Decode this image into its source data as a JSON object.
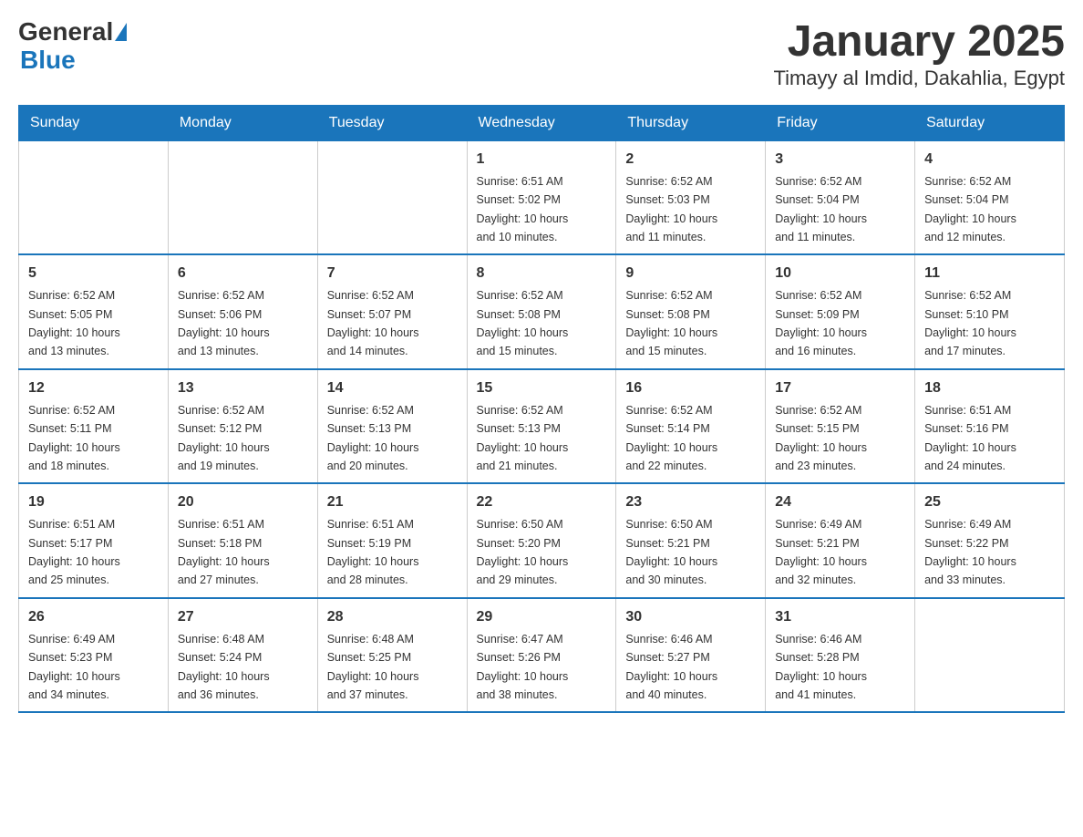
{
  "logo": {
    "part1": "General",
    "part2": "Blue"
  },
  "title": "January 2025",
  "subtitle": "Timayy al Imdid, Dakahlia, Egypt",
  "days_of_week": [
    "Sunday",
    "Monday",
    "Tuesday",
    "Wednesday",
    "Thursday",
    "Friday",
    "Saturday"
  ],
  "weeks": [
    [
      {
        "day": "",
        "info": ""
      },
      {
        "day": "",
        "info": ""
      },
      {
        "day": "",
        "info": ""
      },
      {
        "day": "1",
        "info": "Sunrise: 6:51 AM\nSunset: 5:02 PM\nDaylight: 10 hours\nand 10 minutes."
      },
      {
        "day": "2",
        "info": "Sunrise: 6:52 AM\nSunset: 5:03 PM\nDaylight: 10 hours\nand 11 minutes."
      },
      {
        "day": "3",
        "info": "Sunrise: 6:52 AM\nSunset: 5:04 PM\nDaylight: 10 hours\nand 11 minutes."
      },
      {
        "day": "4",
        "info": "Sunrise: 6:52 AM\nSunset: 5:04 PM\nDaylight: 10 hours\nand 12 minutes."
      }
    ],
    [
      {
        "day": "5",
        "info": "Sunrise: 6:52 AM\nSunset: 5:05 PM\nDaylight: 10 hours\nand 13 minutes."
      },
      {
        "day": "6",
        "info": "Sunrise: 6:52 AM\nSunset: 5:06 PM\nDaylight: 10 hours\nand 13 minutes."
      },
      {
        "day": "7",
        "info": "Sunrise: 6:52 AM\nSunset: 5:07 PM\nDaylight: 10 hours\nand 14 minutes."
      },
      {
        "day": "8",
        "info": "Sunrise: 6:52 AM\nSunset: 5:08 PM\nDaylight: 10 hours\nand 15 minutes."
      },
      {
        "day": "9",
        "info": "Sunrise: 6:52 AM\nSunset: 5:08 PM\nDaylight: 10 hours\nand 15 minutes."
      },
      {
        "day": "10",
        "info": "Sunrise: 6:52 AM\nSunset: 5:09 PM\nDaylight: 10 hours\nand 16 minutes."
      },
      {
        "day": "11",
        "info": "Sunrise: 6:52 AM\nSunset: 5:10 PM\nDaylight: 10 hours\nand 17 minutes."
      }
    ],
    [
      {
        "day": "12",
        "info": "Sunrise: 6:52 AM\nSunset: 5:11 PM\nDaylight: 10 hours\nand 18 minutes."
      },
      {
        "day": "13",
        "info": "Sunrise: 6:52 AM\nSunset: 5:12 PM\nDaylight: 10 hours\nand 19 minutes."
      },
      {
        "day": "14",
        "info": "Sunrise: 6:52 AM\nSunset: 5:13 PM\nDaylight: 10 hours\nand 20 minutes."
      },
      {
        "day": "15",
        "info": "Sunrise: 6:52 AM\nSunset: 5:13 PM\nDaylight: 10 hours\nand 21 minutes."
      },
      {
        "day": "16",
        "info": "Sunrise: 6:52 AM\nSunset: 5:14 PM\nDaylight: 10 hours\nand 22 minutes."
      },
      {
        "day": "17",
        "info": "Sunrise: 6:52 AM\nSunset: 5:15 PM\nDaylight: 10 hours\nand 23 minutes."
      },
      {
        "day": "18",
        "info": "Sunrise: 6:51 AM\nSunset: 5:16 PM\nDaylight: 10 hours\nand 24 minutes."
      }
    ],
    [
      {
        "day": "19",
        "info": "Sunrise: 6:51 AM\nSunset: 5:17 PM\nDaylight: 10 hours\nand 25 minutes."
      },
      {
        "day": "20",
        "info": "Sunrise: 6:51 AM\nSunset: 5:18 PM\nDaylight: 10 hours\nand 27 minutes."
      },
      {
        "day": "21",
        "info": "Sunrise: 6:51 AM\nSunset: 5:19 PM\nDaylight: 10 hours\nand 28 minutes."
      },
      {
        "day": "22",
        "info": "Sunrise: 6:50 AM\nSunset: 5:20 PM\nDaylight: 10 hours\nand 29 minutes."
      },
      {
        "day": "23",
        "info": "Sunrise: 6:50 AM\nSunset: 5:21 PM\nDaylight: 10 hours\nand 30 minutes."
      },
      {
        "day": "24",
        "info": "Sunrise: 6:49 AM\nSunset: 5:21 PM\nDaylight: 10 hours\nand 32 minutes."
      },
      {
        "day": "25",
        "info": "Sunrise: 6:49 AM\nSunset: 5:22 PM\nDaylight: 10 hours\nand 33 minutes."
      }
    ],
    [
      {
        "day": "26",
        "info": "Sunrise: 6:49 AM\nSunset: 5:23 PM\nDaylight: 10 hours\nand 34 minutes."
      },
      {
        "day": "27",
        "info": "Sunrise: 6:48 AM\nSunset: 5:24 PM\nDaylight: 10 hours\nand 36 minutes."
      },
      {
        "day": "28",
        "info": "Sunrise: 6:48 AM\nSunset: 5:25 PM\nDaylight: 10 hours\nand 37 minutes."
      },
      {
        "day": "29",
        "info": "Sunrise: 6:47 AM\nSunset: 5:26 PM\nDaylight: 10 hours\nand 38 minutes."
      },
      {
        "day": "30",
        "info": "Sunrise: 6:46 AM\nSunset: 5:27 PM\nDaylight: 10 hours\nand 40 minutes."
      },
      {
        "day": "31",
        "info": "Sunrise: 6:46 AM\nSunset: 5:28 PM\nDaylight: 10 hours\nand 41 minutes."
      },
      {
        "day": "",
        "info": ""
      }
    ]
  ]
}
